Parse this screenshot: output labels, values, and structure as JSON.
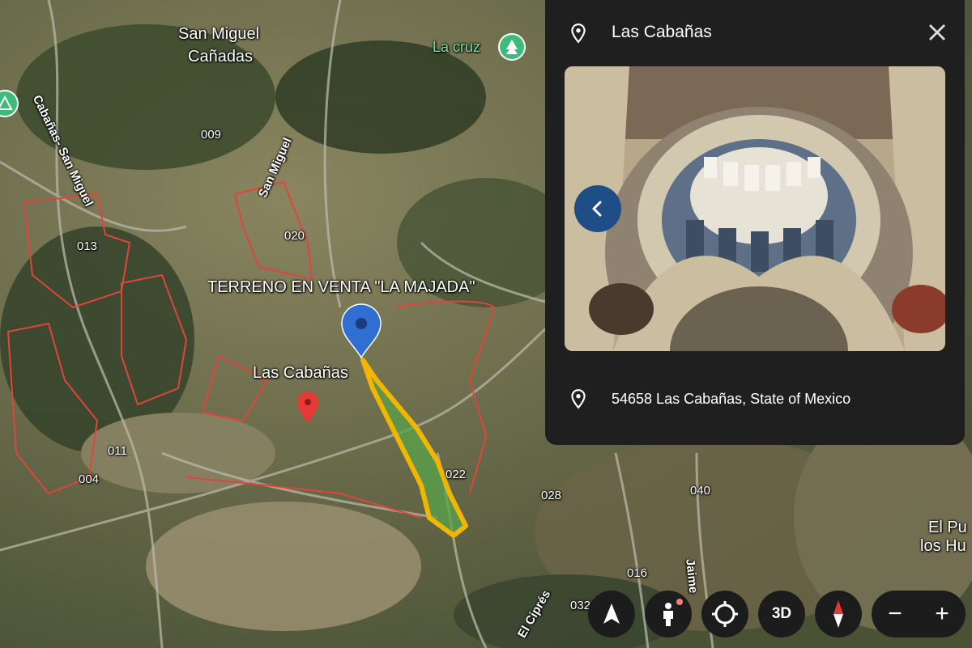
{
  "map": {
    "plot_labels": [
      "009",
      "013",
      "020",
      "011",
      "004",
      "022",
      "028",
      "040",
      "016",
      "032"
    ],
    "place_labels": [
      "San Miguel",
      "Cañadas",
      "Las Cabañas",
      "El Pu",
      "los Hu"
    ],
    "road_labels": [
      "Cabañas- San Miguel",
      "San Miguel",
      "El Ciprés",
      "Jaime"
    ],
    "poi_label": "La cruz",
    "parcel_title": "TERRENO EN VENTA \"LA MAJADA\"",
    "colors": {
      "parcel_border": "#e0453c",
      "highlight": "#f2b600",
      "highlight_fill": "#5aa34a",
      "pin_blue": "#2f6fd1",
      "pin_red": "#e53935",
      "poi_green": "#3dbb7a"
    }
  },
  "panel": {
    "title": "Las Cabañas",
    "address": "54658 Las Cabañas, State of Mexico",
    "icons": [
      "location-pin-icon",
      "close-icon",
      "chevron-left-icon"
    ]
  },
  "controls": {
    "three_d": "3D",
    "zoom_out": "−",
    "zoom_in": "+",
    "icons": [
      "navigate-arrow-icon",
      "pegman-icon",
      "my-location-icon",
      "compass-icon"
    ]
  }
}
